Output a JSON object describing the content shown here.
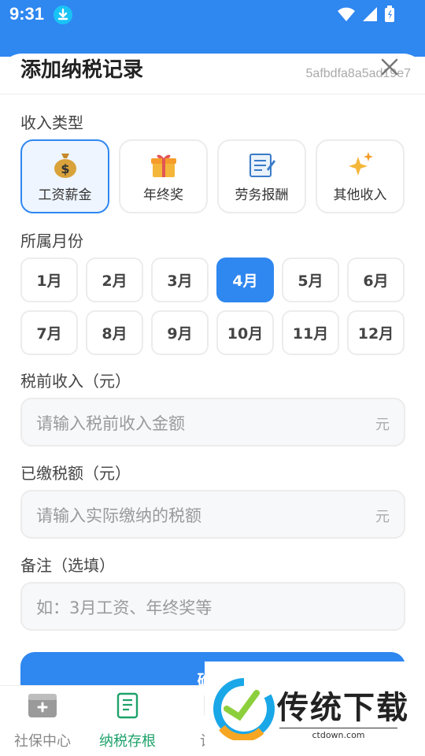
{
  "status_bar": {
    "time": "9:31"
  },
  "sheet": {
    "title": "添加纳税记录",
    "record_id": "5afbdfa8a5ad19e7"
  },
  "income_type": {
    "label": "收入类型",
    "options": [
      {
        "label": "工资薪金",
        "icon": "money-bag-icon",
        "selected": true
      },
      {
        "label": "年终奖",
        "icon": "gift-icon",
        "selected": false
      },
      {
        "label": "劳务报酬",
        "icon": "memo-icon",
        "selected": false
      },
      {
        "label": "其他收入",
        "icon": "sparkles-icon",
        "selected": false
      }
    ]
  },
  "month": {
    "label": "所属月份",
    "options": [
      "1月",
      "2月",
      "3月",
      "4月",
      "5月",
      "6月",
      "7月",
      "8月",
      "9月",
      "10月",
      "11月",
      "12月"
    ],
    "selected": "4月"
  },
  "pre_tax_income": {
    "label": "税前收入（元）",
    "placeholder": "请输入税前收入金额",
    "unit": "元"
  },
  "tax_paid": {
    "label": "已缴税额（元）",
    "placeholder": "请输入实际缴纳的税额",
    "unit": "元"
  },
  "remark": {
    "label": "备注（选填）",
    "placeholder": "如：3月工资、年终奖等"
  },
  "confirm_button": {
    "label": "确认"
  },
  "bottom_nav": [
    {
      "label": "社保中心",
      "icon": "wallet-icon",
      "active": false
    },
    {
      "label": "纳税存根",
      "icon": "tax-receipt-icon",
      "active": true
    },
    {
      "label": "计算",
      "icon": "calculator-icon",
      "active": false
    }
  ],
  "watermark": {
    "text": "传统下载",
    "sub": "ctdown.com"
  },
  "colors": {
    "accent": "#2f87f0",
    "nav_active": "#1ea26a"
  }
}
